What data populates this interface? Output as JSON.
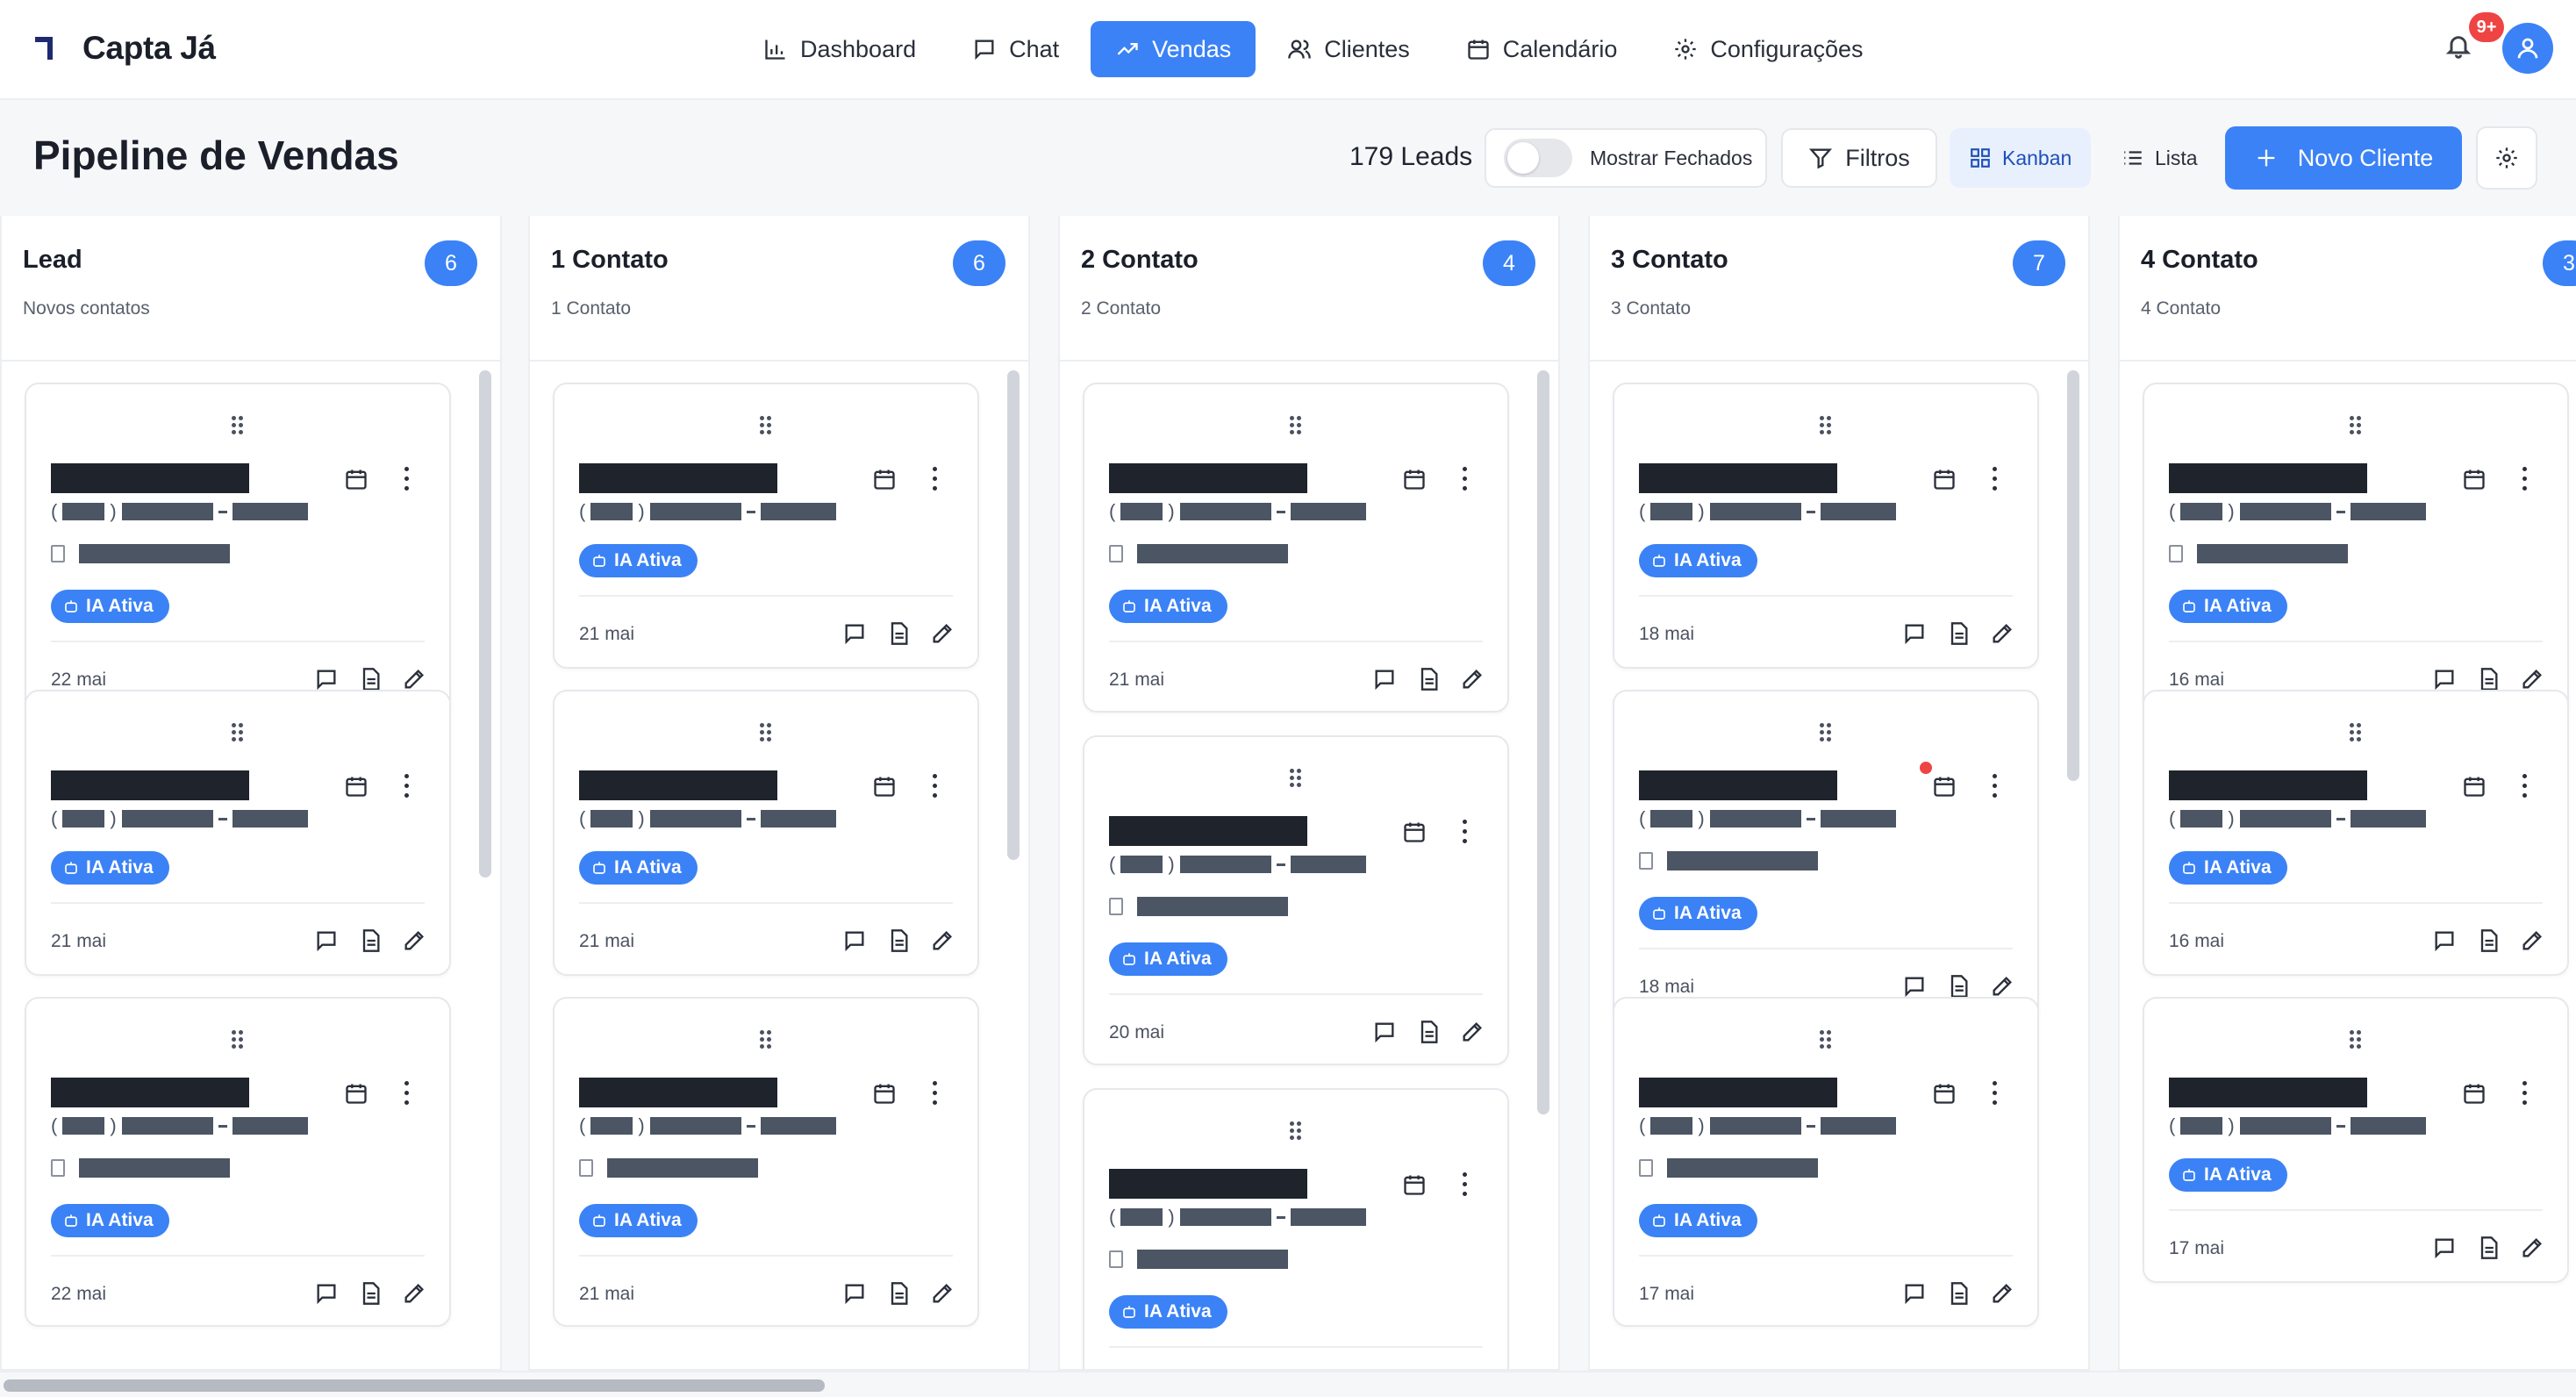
{
  "app": {
    "name": "Capta Já"
  },
  "nav": [
    {
      "label": "Dashboard",
      "icon": "chart-bar-icon",
      "active": false
    },
    {
      "label": "Chat",
      "icon": "message-icon",
      "active": false
    },
    {
      "label": "Vendas",
      "icon": "trending-up-icon",
      "active": true
    },
    {
      "label": "Clientes",
      "icon": "users-icon",
      "active": false
    },
    {
      "label": "Calendário",
      "icon": "calendar-icon",
      "active": false
    },
    {
      "label": "Configurações",
      "icon": "gear-icon",
      "active": false
    }
  ],
  "notifications": {
    "badge": "9+"
  },
  "page": {
    "title": "Pipeline de Vendas",
    "leads_count": "179 Leads",
    "show_closed_label": "Mostrar Fechados",
    "show_closed": false,
    "filters_label": "Filtros",
    "view_kanban": "Kanban",
    "view_list": "Lista",
    "new_client": "Novo Cliente"
  },
  "card_badge": "IA Ativa",
  "columns": [
    {
      "title": "Lead",
      "subtitle": "Novos contatos",
      "count": "6",
      "cards": [
        {
          "date": "22 mai",
          "company": true
        },
        {
          "date": "21 mai",
          "company": false
        },
        {
          "date": "22 mai",
          "company": true
        }
      ]
    },
    {
      "title": "1 Contato",
      "subtitle": "1 Contato",
      "count": "6",
      "cards": [
        {
          "date": "21 mai",
          "company": false
        },
        {
          "date": "21 mai",
          "company": false
        },
        {
          "date": "21 mai",
          "company": true
        }
      ]
    },
    {
      "title": "2 Contato",
      "subtitle": "2 Contato",
      "count": "4",
      "cards": [
        {
          "date": "21 mai",
          "company": true
        },
        {
          "date": "20 mai",
          "company": true
        },
        {
          "date": "",
          "company": true
        }
      ]
    },
    {
      "title": "3 Contato",
      "subtitle": "3 Contato",
      "count": "7",
      "cards": [
        {
          "date": "18 mai",
          "company": false
        },
        {
          "date": "18 mai",
          "company": true,
          "alert": true
        },
        {
          "date": "17 mai",
          "company": true
        }
      ]
    },
    {
      "title": "4 Contato",
      "subtitle": "4 Contato",
      "count": "3",
      "cards": [
        {
          "date": "16 mai",
          "company": true
        },
        {
          "date": "16 mai",
          "company": false
        },
        {
          "date": "17 mai",
          "company": false
        }
      ]
    }
  ]
}
